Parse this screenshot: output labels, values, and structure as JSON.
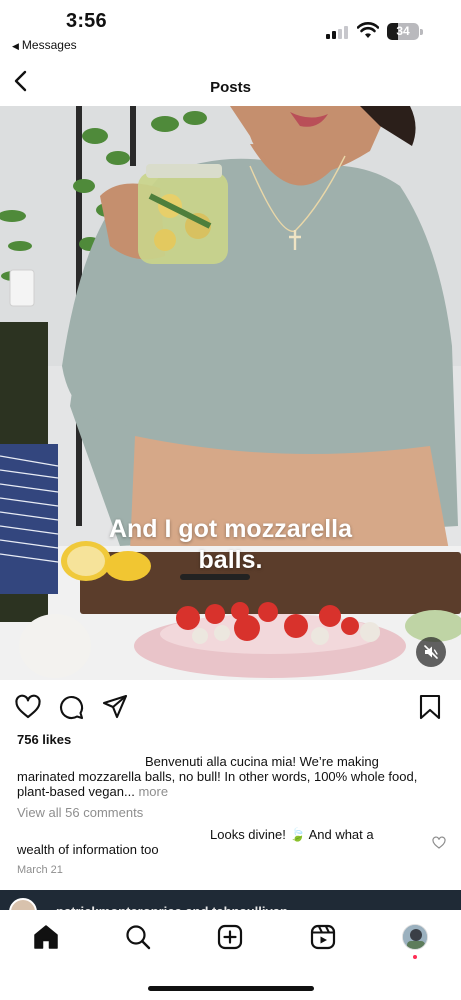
{
  "status_bar": {
    "time": "3:56",
    "back_app": "Messages",
    "battery_level": "34",
    "signal_bars_active": 2,
    "signal_bars_total": 4
  },
  "header": {
    "title": "Posts"
  },
  "post": {
    "video_caption_line1": "And I got mozzarella",
    "video_caption_line2": "balls.",
    "muted": true,
    "likes": "756 likes",
    "caption_line1": "Benvenuti alla cucina mia! We’re making",
    "caption_line2": "marinated mozzarella balls, no bull! In other words, 100% whole food,",
    "caption_line3": "plant-based vegan...",
    "more_label": "more",
    "view_comments": "View all 56 comments",
    "comment_line1": "Looks divine! 🍃 And what a",
    "comment_line2": "wealth of information too",
    "date": "March 21"
  },
  "next_post": {
    "username": "patrickmonteroprice and tahnsullivan"
  },
  "icons": {
    "like": "heart-icon",
    "comment": "comment-bubble-icon",
    "share": "paper-plane-icon",
    "save": "bookmark-icon",
    "mute": "speaker-muted-icon",
    "home": "home-icon",
    "search": "search-icon",
    "create": "plus-square-icon",
    "reels": "reels-icon",
    "profile": "profile-avatar"
  },
  "colors": {
    "secondary_text": "#8e8e8e",
    "notification_dot": "#ff2d55",
    "background": "#ffffff"
  }
}
